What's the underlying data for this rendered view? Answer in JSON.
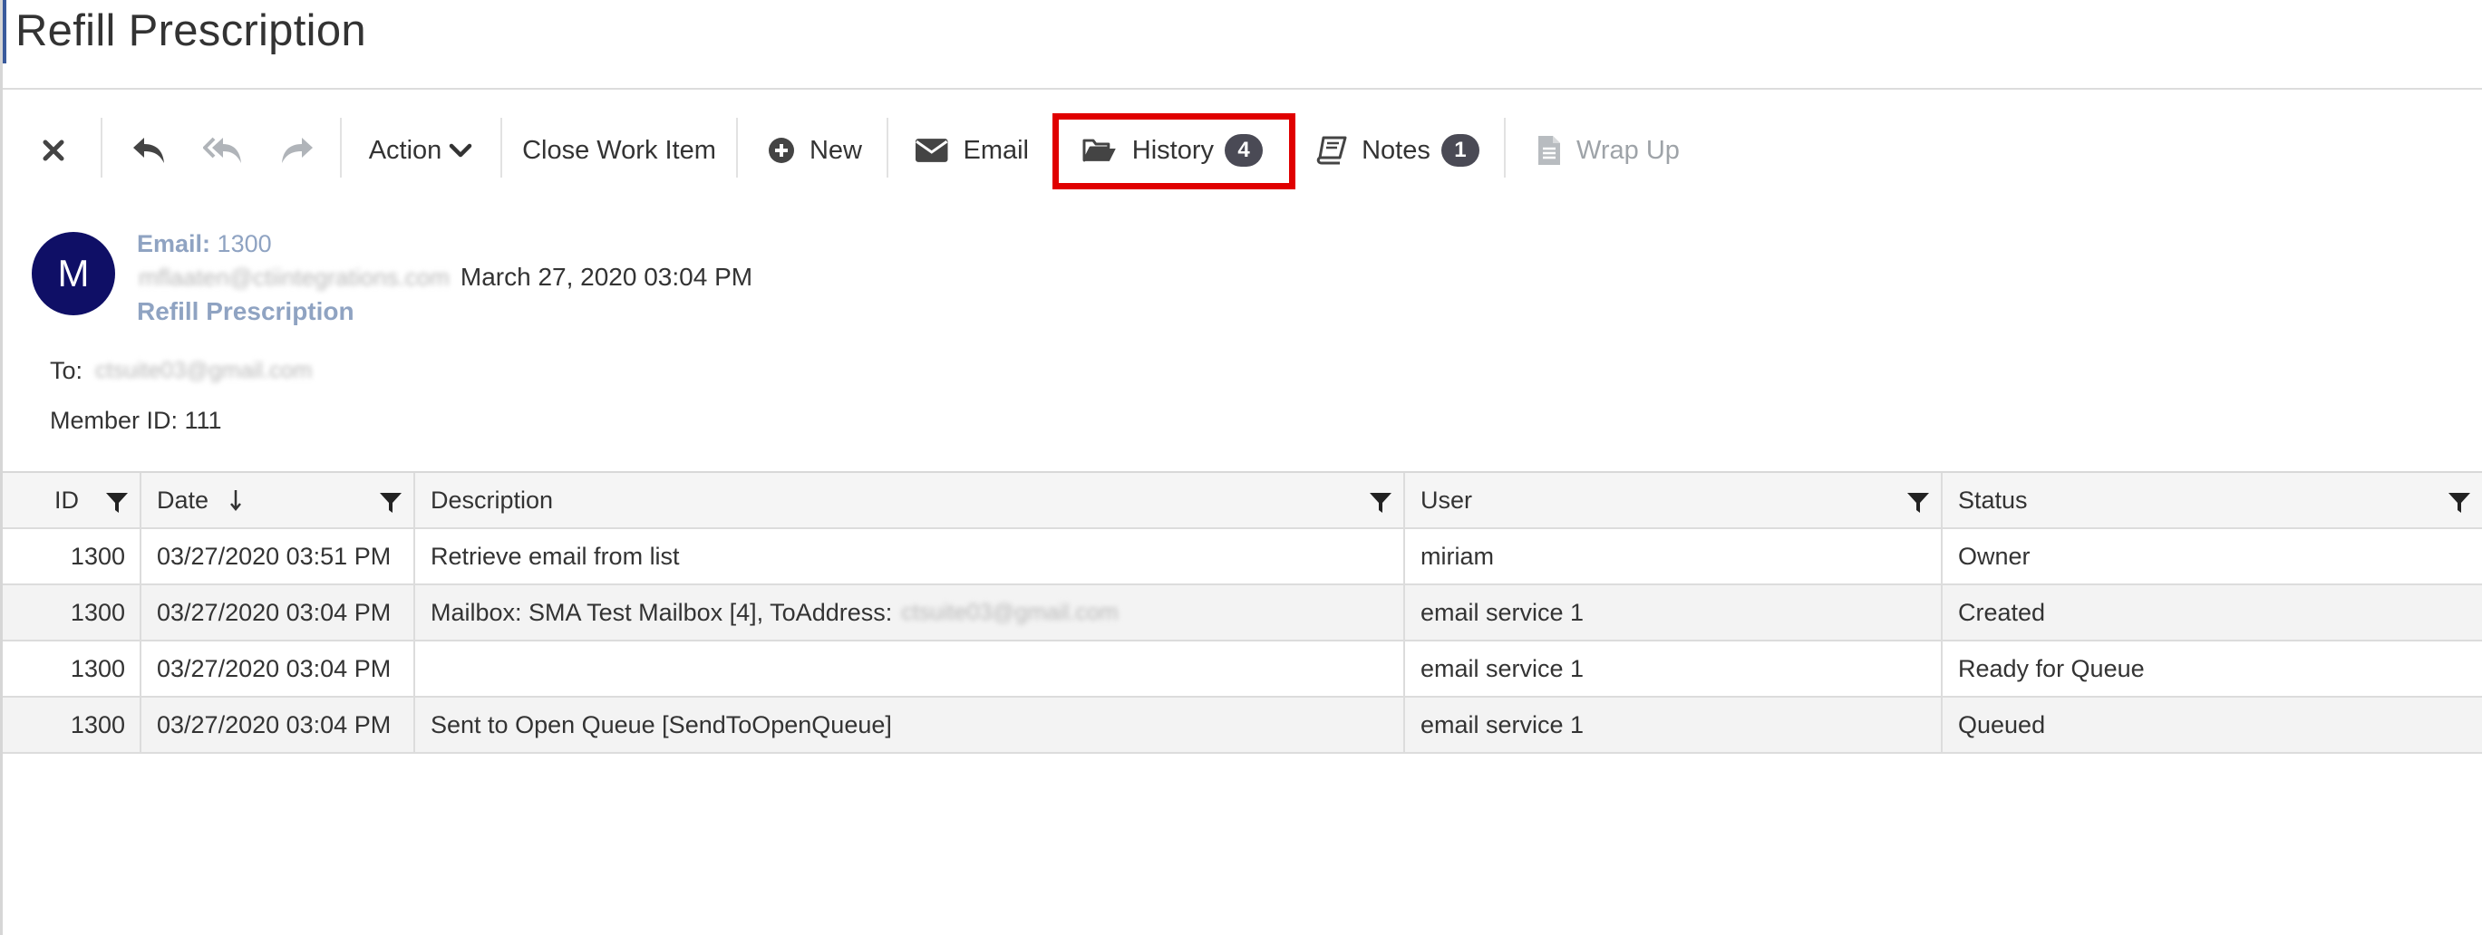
{
  "page": {
    "title": "Refill Prescription"
  },
  "toolbar": {
    "close_icon": "close-icon",
    "reply_icon": "reply-icon",
    "reply_all_icon": "reply-all-icon",
    "forward_icon": "forward-icon",
    "action_label": "Action",
    "close_work_item_label": "Close Work Item",
    "new_label": "New",
    "email_label": "Email",
    "history_label": "History",
    "history_count": "4",
    "notes_label": "Notes",
    "notes_count": "1",
    "wrap_up_label": "Wrap Up",
    "highlight_color": "#e00000"
  },
  "email": {
    "avatar_initial": "M",
    "meta_label": "Email:",
    "meta_id": "1300",
    "sender": "mflaaten@ctiintegrations.com",
    "date": "March 27, 2020 03:04 PM",
    "subject": "Refill Prescription",
    "to_label": "To:",
    "to_address": "ctsuite03@gmail.com",
    "member_id": "Member ID: 111"
  },
  "grid": {
    "columns": [
      "ID",
      "Date",
      "Description",
      "User",
      "Status"
    ],
    "rows": [
      {
        "id": "1300",
        "date": "03/27/2020 03:51 PM",
        "description": "Retrieve email from list",
        "description_blurred": "",
        "user": "miriam",
        "status": "Owner"
      },
      {
        "id": "1300",
        "date": "03/27/2020 03:04 PM",
        "description": "Mailbox: SMA Test Mailbox [4], ToAddress:",
        "description_blurred": "ctsuite03@gmail.com",
        "user": "email service 1",
        "status": "Created"
      },
      {
        "id": "1300",
        "date": "03/27/2020 03:04 PM",
        "description": "",
        "description_blurred": "",
        "user": "email service 1",
        "status": "Ready for Queue"
      },
      {
        "id": "1300",
        "date": "03/27/2020 03:04 PM",
        "description": "Sent to Open Queue [SendToOpenQueue]",
        "description_blurred": "",
        "user": "email service 1",
        "status": "Queued"
      }
    ]
  },
  "colors": {
    "avatar_bg": "#0f0f66",
    "meta_text": "#8fa3c2",
    "badge_bg": "#4a4a55"
  }
}
